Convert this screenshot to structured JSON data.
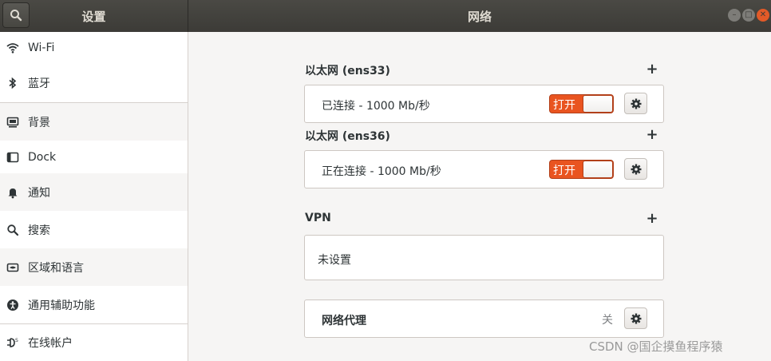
{
  "header": {
    "left_title": "设置",
    "right_title": "网络"
  },
  "sidebar": {
    "items": [
      {
        "label": "Wi-Fi",
        "icon": "wifi-icon"
      },
      {
        "label": "蓝牙",
        "icon": "bluetooth-icon"
      },
      {
        "label": "背景",
        "icon": "background-icon"
      },
      {
        "label": "Dock",
        "icon": "dock-icon"
      },
      {
        "label": "通知",
        "icon": "bell-icon"
      },
      {
        "label": "搜索",
        "icon": "search-icon"
      },
      {
        "label": "区域和语言",
        "icon": "region-icon"
      },
      {
        "label": "通用辅助功能",
        "icon": "accessibility-icon"
      },
      {
        "label": "在线帐户",
        "icon": "online-accounts-icon"
      }
    ]
  },
  "main": {
    "ethernet1": {
      "title": "以太网 (ens33)",
      "status": "已连接 - 1000 Mb/秒",
      "toggle_label": "打开"
    },
    "ethernet2": {
      "title": "以太网 (ens36)",
      "status": "正在连接 - 1000 Mb/秒",
      "toggle_label": "打开"
    },
    "vpn": {
      "title": "VPN",
      "empty_label": "未设置"
    },
    "proxy": {
      "title": "网络代理",
      "state": "关"
    }
  },
  "watermark": "CSDN @国企摸鱼程序猿",
  "colors": {
    "accent": "#e95420",
    "header_bg": "#3c3b37",
    "window_bg": "#f6f5f4"
  }
}
